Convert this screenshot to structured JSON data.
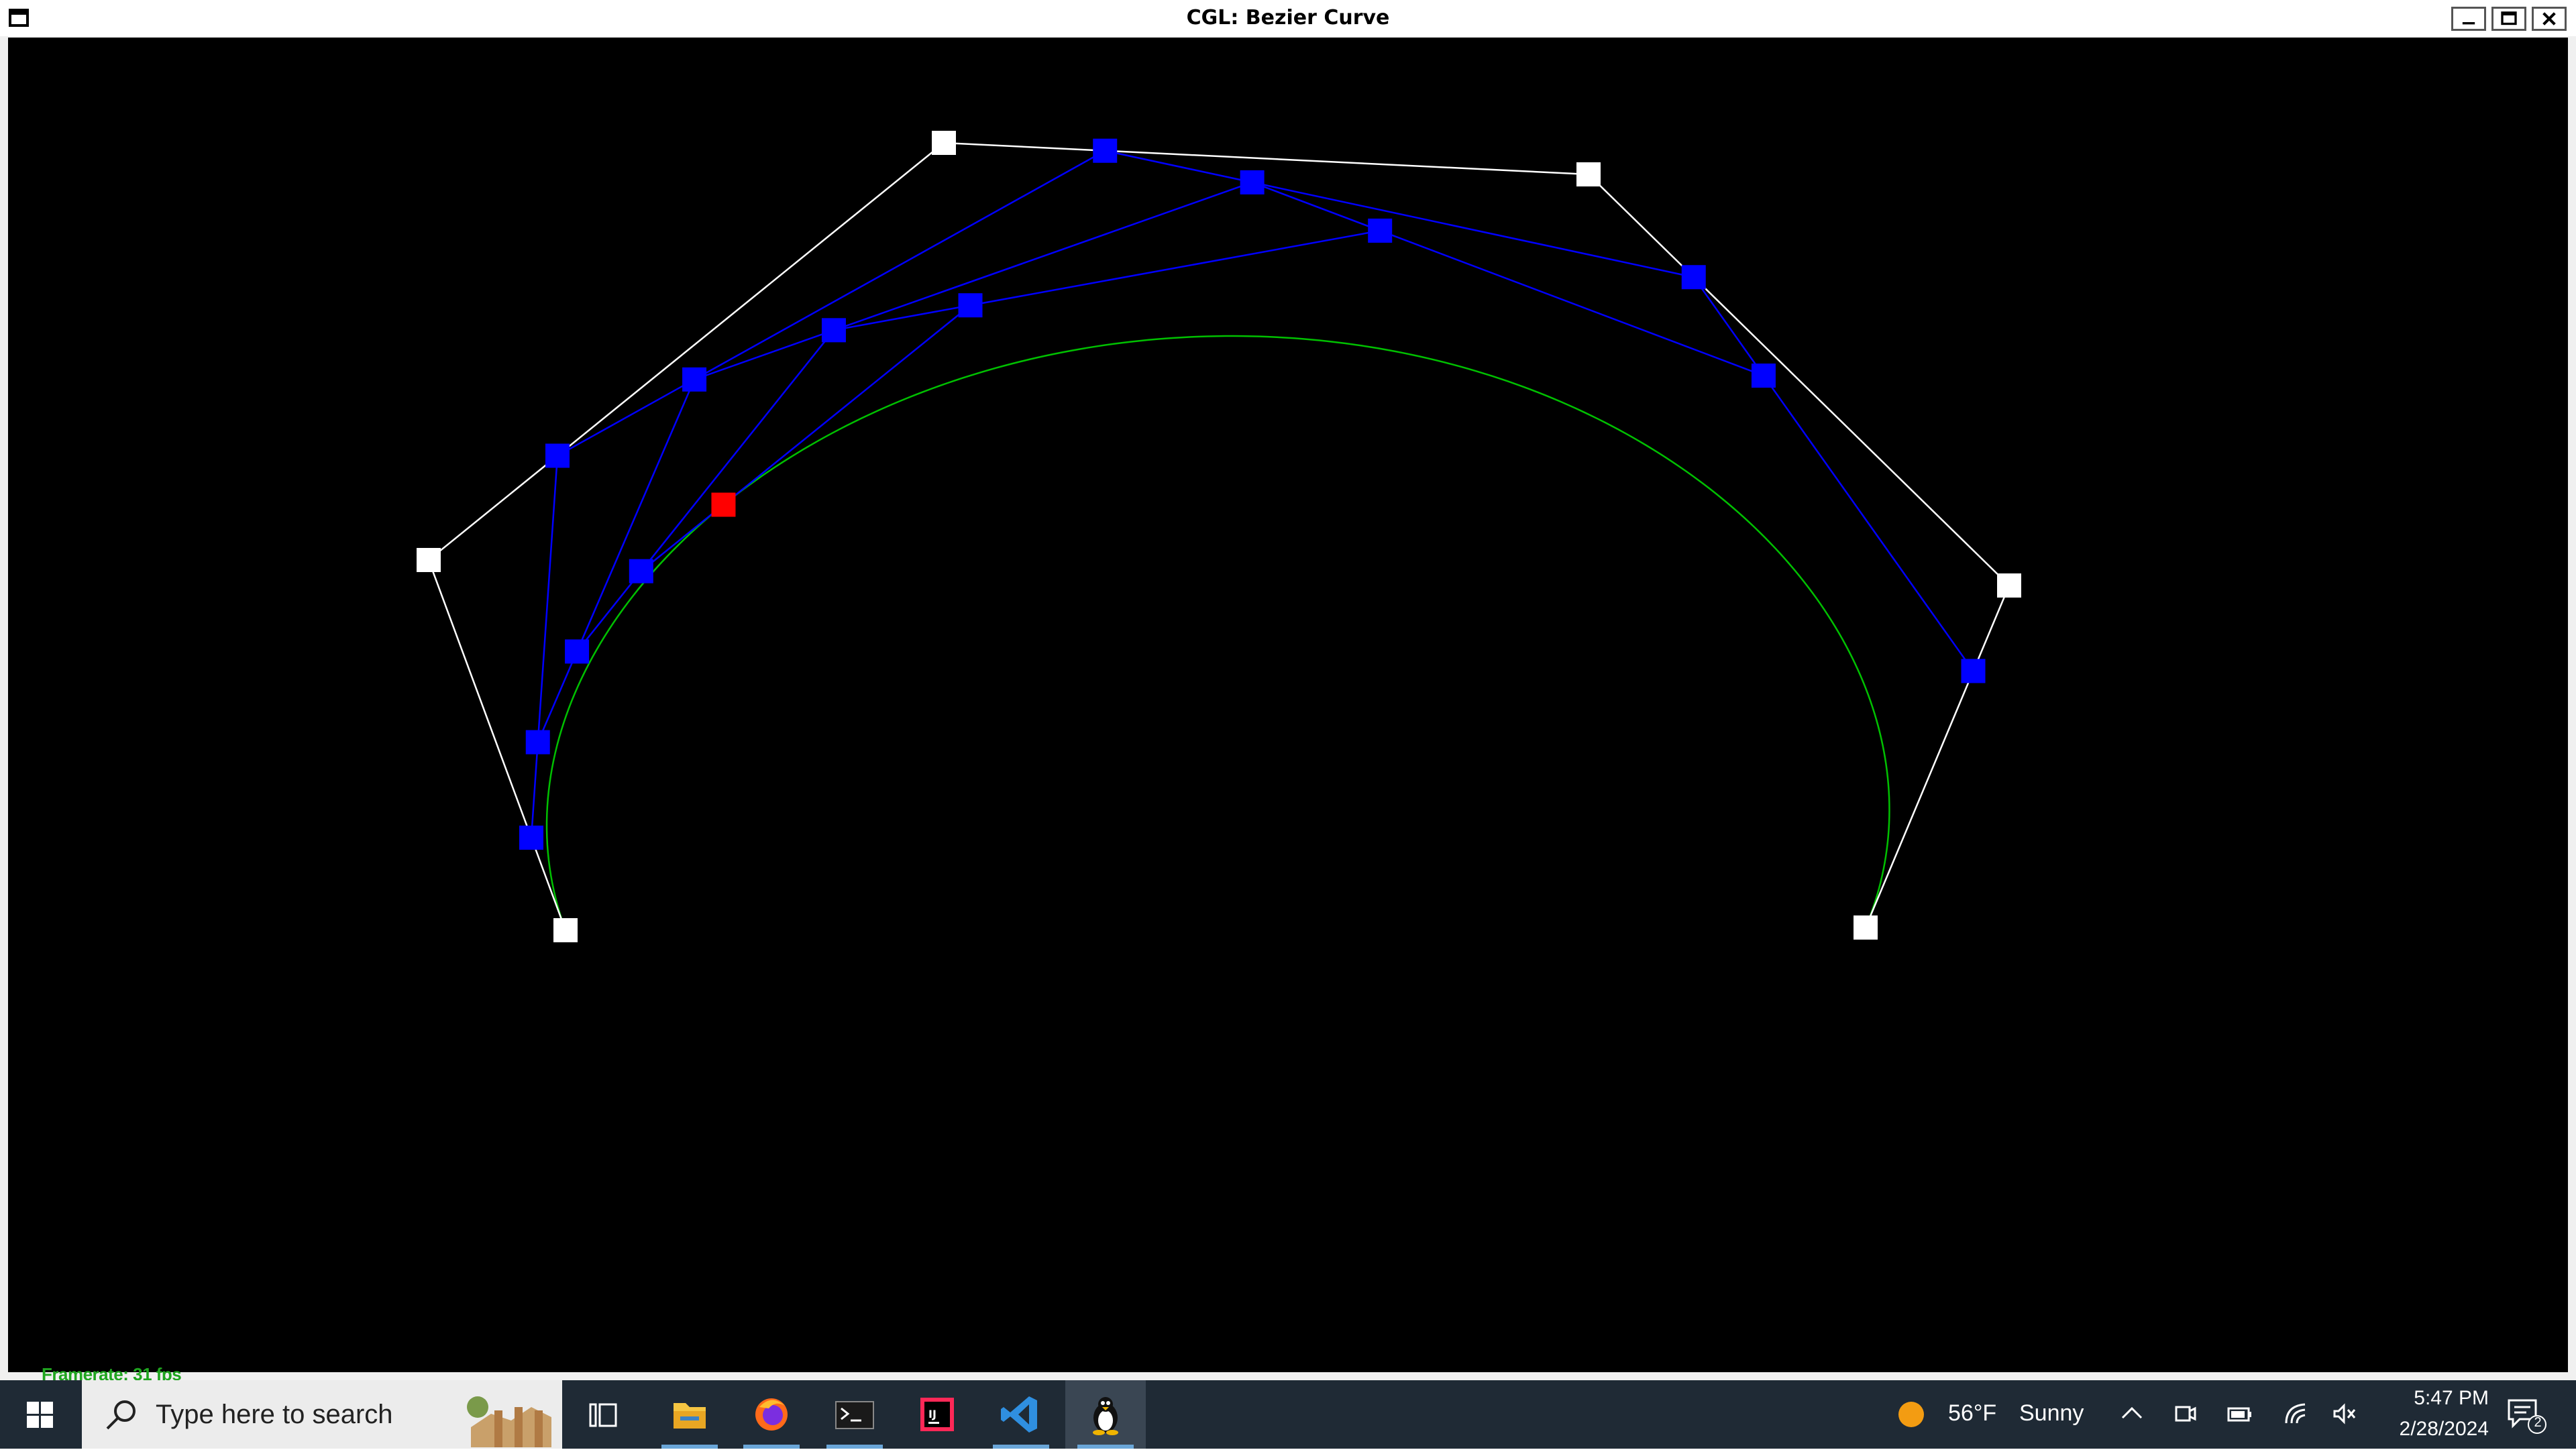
{
  "window": {
    "title": "CGL: Bezier Curve",
    "framerate_text": "Framerate: 31 fps"
  },
  "scene": {
    "colors": {
      "background": "#000000",
      "control_polygon": "#ffffff",
      "control_point": "#ffffff",
      "intermediate": "#0000ff",
      "selected_point": "#ff0000",
      "curve": "#00c000",
      "framerate": "#1fa51f"
    },
    "curve_parameter_t": 0.25
  },
  "taskbar": {
    "search_placeholder": "Type here to search",
    "weather_temp": "56°F",
    "weather_desc": "Sunny",
    "time": "5:47 PM",
    "date": "2/28/2024",
    "notification_count": "2",
    "apps": [
      {
        "name": "task-view-icon"
      },
      {
        "name": "file-explorer-icon",
        "running": true
      },
      {
        "name": "firefox-icon",
        "running": true
      },
      {
        "name": "terminal-icon",
        "running": true
      },
      {
        "name": "intellij-icon"
      },
      {
        "name": "vscode-icon",
        "running": true
      },
      {
        "name": "linux-tux-icon",
        "running": true,
        "active": true
      }
    ],
    "colors": {
      "background": "#1f2a35",
      "indicator": "#6aa6d8",
      "weather_sun": "#f39c12"
    }
  }
}
